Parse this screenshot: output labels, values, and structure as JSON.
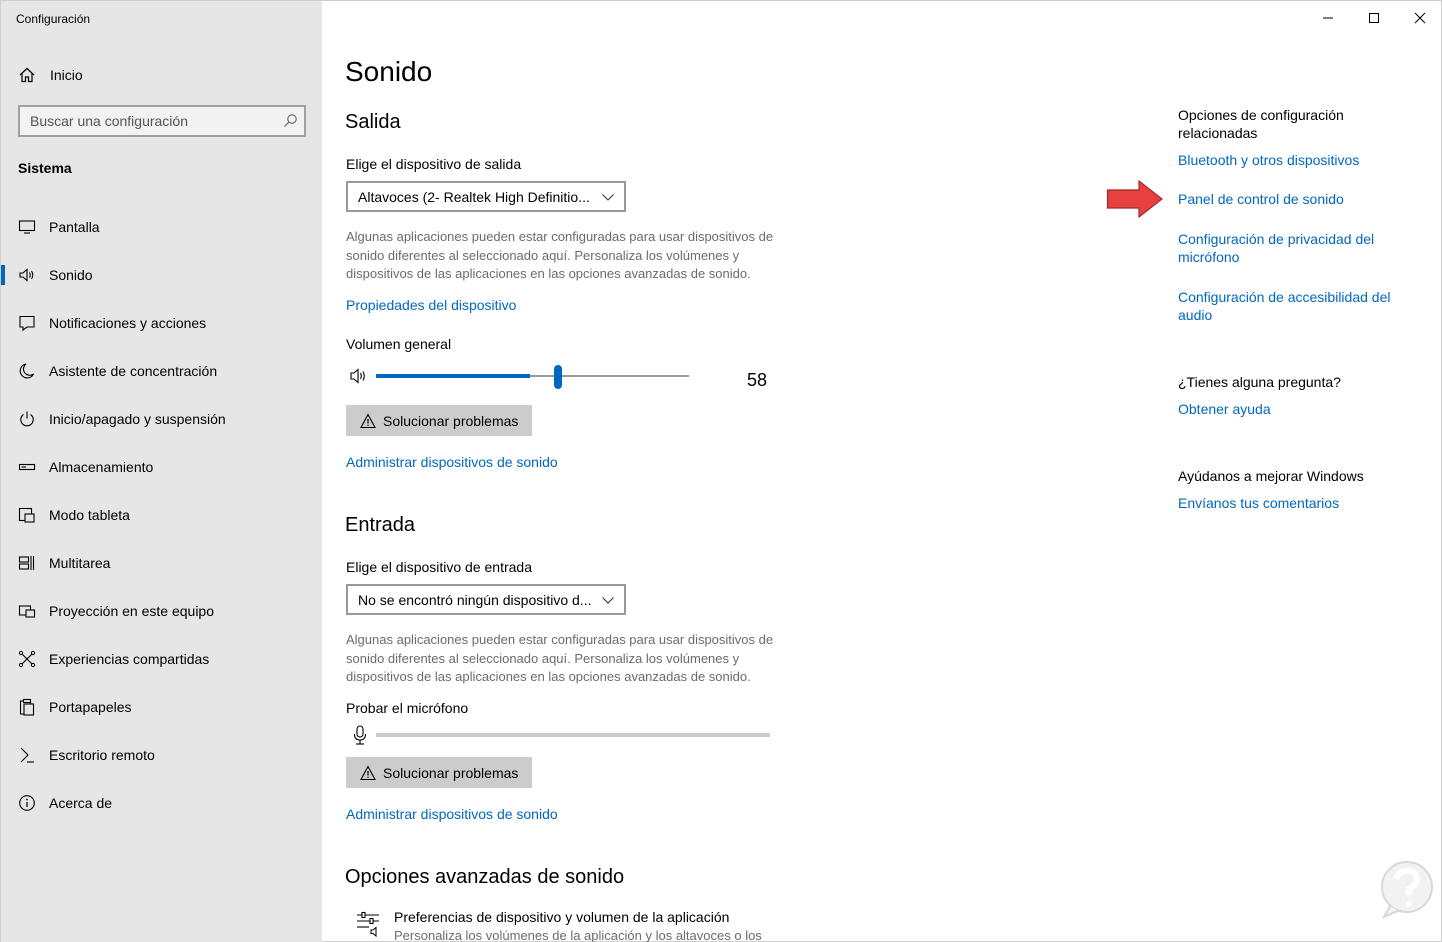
{
  "app": {
    "title": "Configuración"
  },
  "sidebar": {
    "home_label": "Inicio",
    "search_placeholder": "Buscar una configuración",
    "section": "Sistema",
    "items": [
      {
        "label": "Pantalla",
        "icon": "display-icon"
      },
      {
        "label": "Sonido",
        "icon": "speaker-icon",
        "active": true
      },
      {
        "label": "Notificaciones y acciones",
        "icon": "notification-icon"
      },
      {
        "label": "Asistente de concentración",
        "icon": "moon-icon"
      },
      {
        "label": "Inicio/apagado y suspensión",
        "icon": "power-icon"
      },
      {
        "label": "Almacenamiento",
        "icon": "storage-icon"
      },
      {
        "label": "Modo tableta",
        "icon": "tablet-icon"
      },
      {
        "label": "Multitarea",
        "icon": "multitask-icon"
      },
      {
        "label": "Proyección en este equipo",
        "icon": "projection-icon"
      },
      {
        "label": "Experiencias compartidas",
        "icon": "shared-icon"
      },
      {
        "label": "Portapapeles",
        "icon": "clipboard-icon"
      },
      {
        "label": "Escritorio remoto",
        "icon": "remote-icon"
      },
      {
        "label": "Acerca de",
        "icon": "info-icon"
      }
    ]
  },
  "main": {
    "title": "Sonido",
    "output": {
      "heading": "Salida",
      "device_label": "Elige el dispositivo de salida",
      "device_value": "Altavoces (2- Realtek High Definitio...",
      "description": "Algunas aplicaciones pueden estar configuradas para usar dispositivos de sonido diferentes al seleccionado aquí. Personaliza los volúmenes y dispositivos de las aplicaciones en las opciones avanzadas de sonido.",
      "properties_link": "Propiedades del dispositivo",
      "volume_label": "Volumen general",
      "volume_value": "58",
      "volume_level": 0.58,
      "troubleshoot_label": "Solucionar problemas",
      "manage_link": "Administrar dispositivos de sonido"
    },
    "input": {
      "heading": "Entrada",
      "device_label": "Elige el dispositivo de entrada",
      "device_value": "No se encontró ningún dispositivo d...",
      "description": "Algunas aplicaciones pueden estar configuradas para usar dispositivos de sonido diferentes al seleccionado aquí. Personaliza los volúmenes y dispositivos de las aplicaciones en las opciones avanzadas de sonido.",
      "test_label": "Probar el micrófono",
      "troubleshoot_label": "Solucionar problemas",
      "manage_link": "Administrar dispositivos de sonido"
    },
    "advanced": {
      "heading": "Opciones avanzadas de sonido",
      "item_title": "Preferencias de dispositivo y volumen de la aplicación",
      "item_desc": "Personaliza los volúmenes de la aplicación y los altavoces o los"
    }
  },
  "related": {
    "heading": "Opciones de configuración relacionadas",
    "links": [
      "Bluetooth y otros dispositivos",
      "Panel de control de sonido",
      "Configuración de privacidad del micrófono",
      "Configuración de accesibilidad del audio"
    ],
    "question_heading": "¿Tienes alguna pregunta?",
    "help_link": "Obtener ayuda",
    "improve_heading": "Ayúdanos a mejorar Windows",
    "feedback_link": "Envíanos tus comentarios"
  },
  "colors": {
    "accent": "#0067c0",
    "sidebar_bg": "#e6e6e6",
    "arrow": "#e8403f"
  }
}
